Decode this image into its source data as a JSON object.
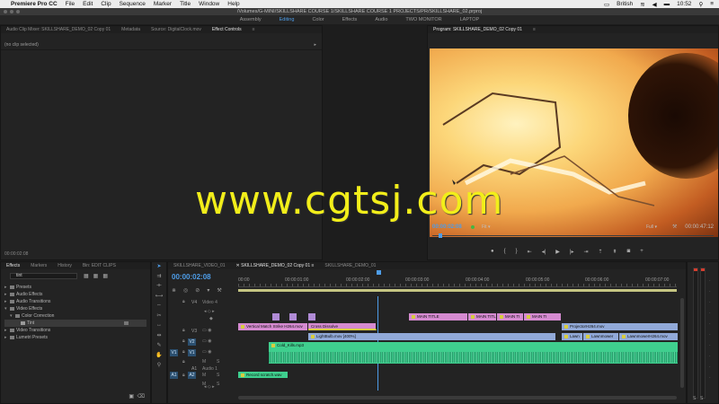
{
  "menubar": {
    "app_name": "Premiere Pro CC",
    "items": [
      "File",
      "Edit",
      "Clip",
      "Sequence",
      "Marker",
      "Title",
      "Window",
      "Help"
    ],
    "input_source": "British",
    "clock": "10:52"
  },
  "window": {
    "title": "/Volumes/G-MINI/SKILLSHARE COURSE 1/SKILLSHARE COURSE 1 PROJECTS/PR/SKILLSHARE_02.prproj"
  },
  "workspaces": [
    "Assembly",
    "Editing",
    "Color",
    "Effects",
    "Audio",
    "TWO MONITOR",
    "LAPTOP"
  ],
  "effect_controls": {
    "tabs": [
      "Audio Clip Mixer: SKILLSHARE_DEMO_02 Copy 01",
      "Metadata",
      "Source: DigitalClock.mov",
      "Effect Controls"
    ],
    "no_clip": "(no clip selected)",
    "timecode": "00:00:02:08"
  },
  "program": {
    "tab": "Program: SKILLSHARE_DEMO_02 Copy 01",
    "timecode": "00:00:02:08",
    "zoom": "Fit",
    "resolution": "Full",
    "duration": "00:00:47:12"
  },
  "effects": {
    "tabs": [
      "Effects",
      "Markers",
      "History",
      "Bin: EDIT CLIPS"
    ],
    "search_value": "tint",
    "tree": [
      {
        "label": "Presets",
        "level": 0,
        "open": false
      },
      {
        "label": "Audio Effects",
        "level": 0,
        "open": false
      },
      {
        "label": "Audio Transitions",
        "level": 0,
        "open": false
      },
      {
        "label": "Video Effects",
        "level": 0,
        "open": true
      },
      {
        "label": "Color Correction",
        "level": 1,
        "open": true
      },
      {
        "label": "Tint",
        "level": 2,
        "selected": true
      },
      {
        "label": "Video Transitions",
        "level": 0,
        "open": false
      },
      {
        "label": "Lumetri Presets",
        "level": 0,
        "open": false
      }
    ]
  },
  "timeline": {
    "tabs": [
      "SKILLSHARE_VIDEO_01",
      "SKILLSHARE_DEMO_02 Copy 01",
      "SKILLSHARE_DEMO_01"
    ],
    "timecode": "00:00:02:08",
    "ruler": [
      "00:00",
      "00:00:01:00",
      "00:00:02:00",
      "00:00:03:00",
      "00:00:04:00",
      "00:00:05:00",
      "00:00:06:00",
      "00:00:07:00"
    ],
    "tracks": {
      "v4": "V4",
      "v4_name": "Video 4",
      "v3": "V3",
      "v2": "V2",
      "v1": "V1",
      "v1_src": "V1",
      "a1": "A1",
      "a1_name": "Audio 1",
      "a1_src": "A1",
      "a2": "A2",
      "m": "M",
      "s": "S"
    },
    "clips": {
      "title1": "MAIN TITLE",
      "title2": "MAIN TITL",
      "title3": "MAIN TI",
      "title4": "MAIN TI",
      "v2_a": "Vertical Match Strike H264.mov",
      "v2_b": "Cross Dissolve",
      "v2_c": "ProjectorH264.mov",
      "v1_a": "LightBulb.mov [400%]",
      "v1_b": "Lawn",
      "v1_c": "Lawnmower",
      "v1_d": "LawnmowerH264.mov",
      "a1": "Cold_Kills.mp3",
      "a2": "Record scratch.wav"
    }
  },
  "watermark": "www.cgtsj.com",
  "colors": {
    "accent": "#4e9de8",
    "video_clip": "#91a9d8",
    "title_clip": "#d58ad0",
    "audio_clip": "#3fcf8e",
    "watermark": "#f2ee1a"
  }
}
